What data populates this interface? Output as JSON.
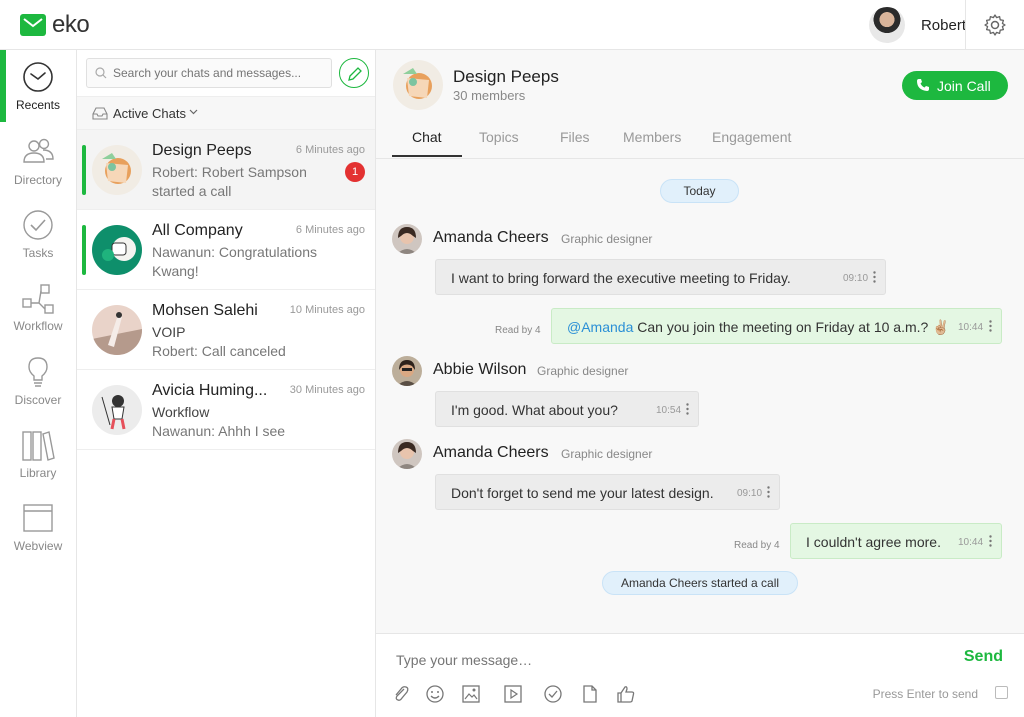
{
  "app": {
    "logo_text": "eko",
    "brand_color": "#1db83f"
  },
  "user": {
    "name": "Robert"
  },
  "nav": [
    {
      "label": "Recents",
      "icon": "clock-icon",
      "active": true
    },
    {
      "label": "Directory",
      "icon": "people-icon"
    },
    {
      "label": "Tasks",
      "icon": "check-circle-icon"
    },
    {
      "label": "Workflow",
      "icon": "workflow-icon"
    },
    {
      "label": "Discover",
      "icon": "lightbulb-icon"
    },
    {
      "label": "Library",
      "icon": "books-icon"
    },
    {
      "label": "Webview",
      "icon": "browser-window-icon"
    }
  ],
  "chatlist": {
    "search_placeholder": "Search your chats and messages...",
    "filter_label": "Active Chats",
    "chats": [
      {
        "name": "Design Peeps",
        "time": "6 Minutes ago",
        "line1": "Robert: Robert Sampson",
        "line2": "started a call",
        "unread": "1"
      },
      {
        "name": "All Company",
        "time": "6 Minutes ago",
        "line1": "Nawanun: Congratulations",
        "line2": "Kwang!"
      },
      {
        "name": "Mohsen Salehi",
        "time": "10 Minutes ago",
        "line1": "VOIP",
        "line2": "Robert: Call canceled"
      },
      {
        "name": "Avicia Huming...",
        "time": "30 Minutes ago",
        "line1": "Workflow",
        "line2": "Nawanun: Ahhh I see"
      }
    ]
  },
  "conversation": {
    "title": "Design Peeps",
    "members": "30 members",
    "join_call_label": "Join Call",
    "tabs": [
      "Chat",
      "Topics",
      "Files",
      "Members",
      "Engagement"
    ],
    "date_separator": "Today",
    "messages": [
      {
        "sender": "Amanda Cheers",
        "role": "Graphic designer",
        "text": "I want to bring forward the executive meeting to Friday.",
        "time": "09:10"
      },
      {
        "mine": true,
        "mention": "@Amanda",
        "text": "Can you join the meeting on Friday at 10 a.m.? ✌🏼",
        "time": "10:44",
        "read_by": "Read by 4"
      },
      {
        "sender": "Abbie Wilson",
        "role": "Graphic designer",
        "text": "I'm good.  What about you?",
        "time": "10:54"
      },
      {
        "sender": "Amanda Cheers",
        "role": "Graphic designer",
        "text": "Don't forget to send me your latest design.",
        "time": "09:10"
      },
      {
        "mine": true,
        "text": "I couldn't agree more.",
        "time": "10:44",
        "read_by": "Read by 4"
      }
    ],
    "system_event": "Amanda Cheers started a call",
    "composer": {
      "placeholder": "Type your message…",
      "send_label": "Send",
      "enter_hint": "Press Enter to send"
    }
  }
}
